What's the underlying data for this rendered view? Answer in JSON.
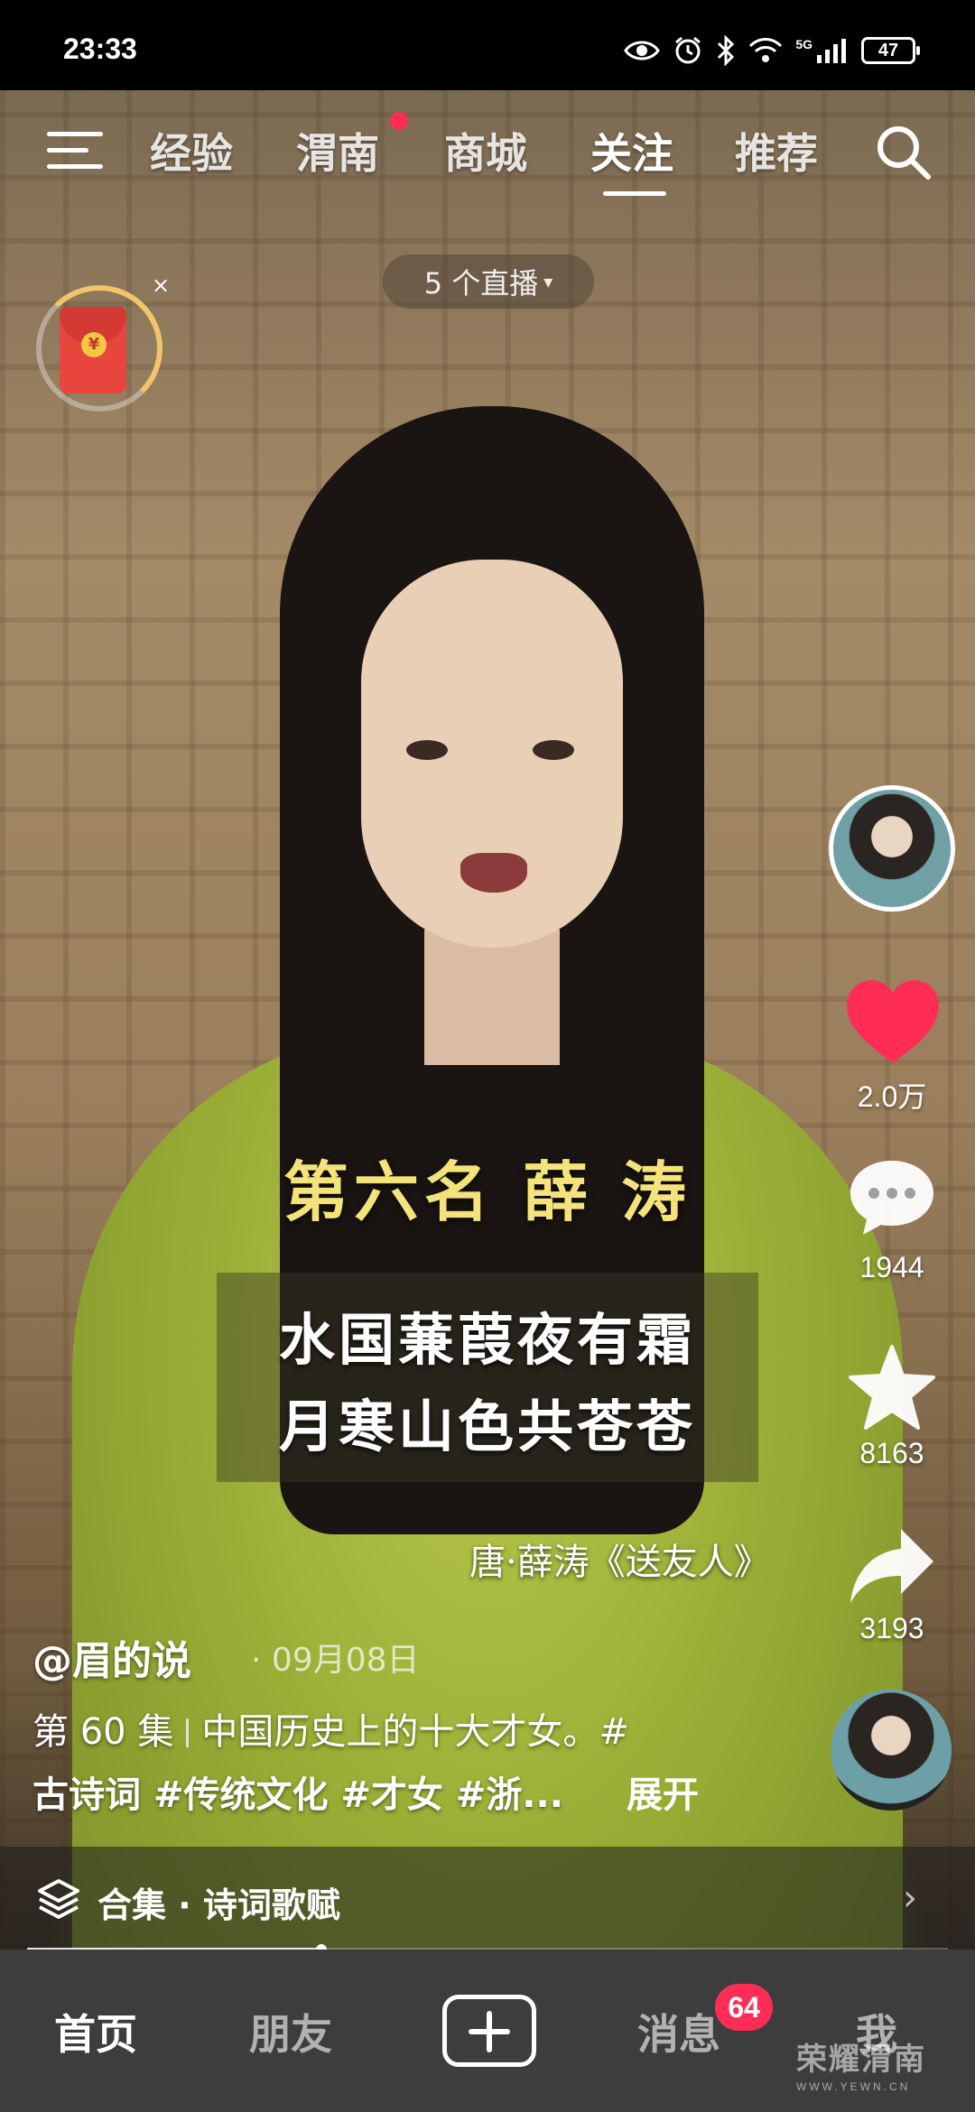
{
  "status_bar": {
    "time": "23:33",
    "network": "5G",
    "battery": "47"
  },
  "top_nav": {
    "tabs": [
      "经验",
      "渭南",
      "商城",
      "关注",
      "推荐"
    ],
    "active_tab": "关注",
    "dot_on_tab": "渭南"
  },
  "live_pill": "5 个直播",
  "video_overlay": {
    "title": "第六名  薛  涛",
    "poem_line1": "水国蒹葭夜有霜",
    "poem_line2": "月寒山色共苍苍",
    "source": "唐·薛涛《送友人》"
  },
  "actions": {
    "likes": "2.0万",
    "comments": "1944",
    "favorites": "8163",
    "shares": "3193"
  },
  "post": {
    "author": "@眉的说",
    "date": "· 09月08日",
    "episode": "第 60 集",
    "desc_text": "中国历史上的十大才女。#",
    "hashtags": "古诗词 #传统文化 #才女 #浙...",
    "expand": "展开"
  },
  "collection": {
    "label": "合集 · 诗词歌赋"
  },
  "progress": 0.32,
  "tab_bar": {
    "home": "首页",
    "friends": "朋友",
    "messages": "消息",
    "me": "我",
    "message_badge": "64"
  },
  "watermark": {
    "main": "荣耀渭南",
    "sub": "WWW.YEWN.CN"
  },
  "colors": {
    "heart": "#ff2d55",
    "badge": "#ff2d55",
    "caption_gold": "#f4e37a"
  }
}
